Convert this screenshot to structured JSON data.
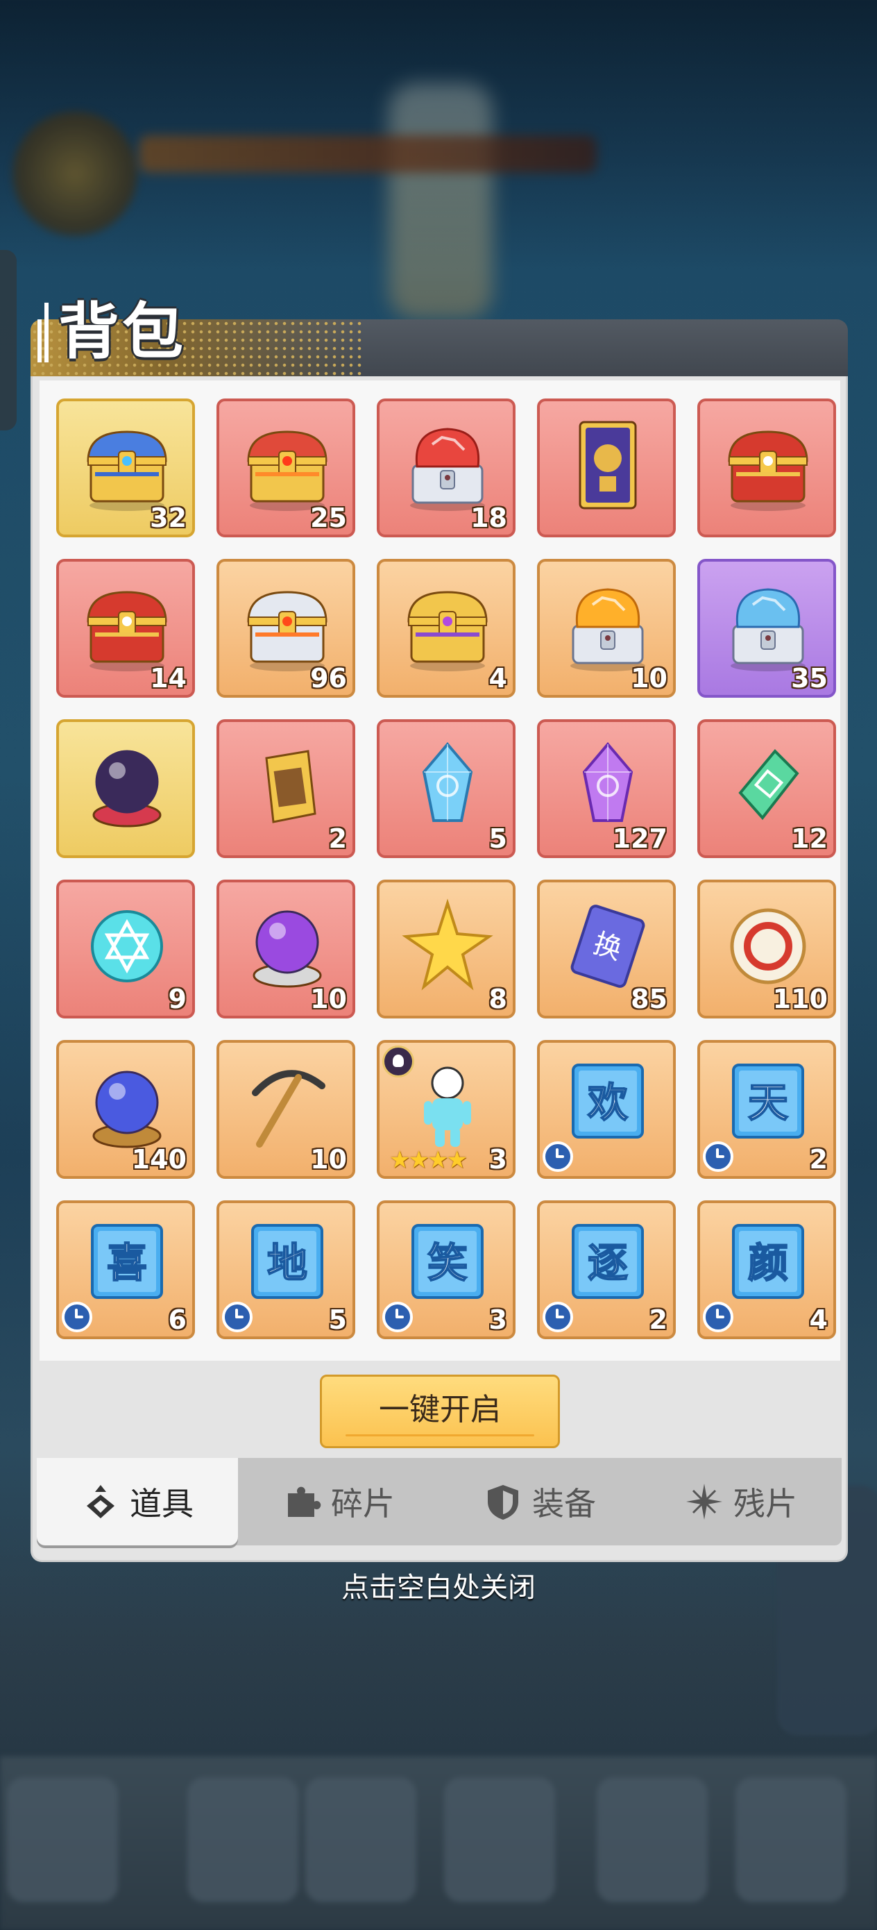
{
  "title": "背包",
  "items": [
    {
      "name": "gold-blue-chest",
      "count": "32",
      "bg": "gold"
    },
    {
      "name": "red-flame-chest",
      "count": "25",
      "bg": "red"
    },
    {
      "name": "red-gem-chest",
      "count": "18",
      "bg": "red"
    },
    {
      "name": "purple-card",
      "count": "",
      "bg": "red"
    },
    {
      "name": "red-gold-chest",
      "count": "",
      "bg": "red"
    },
    {
      "name": "red-gold-chest",
      "count": "14",
      "bg": "red"
    },
    {
      "name": "silver-flame-chest",
      "count": "96",
      "bg": "orange"
    },
    {
      "name": "gold-purple-chest",
      "count": "4",
      "bg": "orange"
    },
    {
      "name": "orange-gem-chest",
      "count": "10",
      "bg": "orange"
    },
    {
      "name": "blue-gem-chest",
      "count": "35",
      "bg": "purple"
    },
    {
      "name": "crystal-ball",
      "count": "",
      "bg": "gold"
    },
    {
      "name": "general-token",
      "count": "2",
      "bg": "red"
    },
    {
      "name": "blue-crystal",
      "count": "5",
      "bg": "red"
    },
    {
      "name": "purple-crystal",
      "count": "127",
      "bg": "red"
    },
    {
      "name": "green-token",
      "count": "12",
      "bg": "red"
    },
    {
      "name": "hexagram-orb",
      "count": "9",
      "bg": "red"
    },
    {
      "name": "purple-orb",
      "count": "10",
      "bg": "red"
    },
    {
      "name": "gold-star",
      "count": "8",
      "bg": "orange"
    },
    {
      "name": "exchange-ticket",
      "count": "85",
      "bg": "orange"
    },
    {
      "name": "dragon-coin",
      "count": "110",
      "bg": "orange"
    },
    {
      "name": "blue-orb",
      "count": "140",
      "bg": "orange"
    },
    {
      "name": "pickaxe",
      "count": "10",
      "bg": "orange"
    },
    {
      "name": "character-figure",
      "count": "3",
      "bg": "orange",
      "stars": "★★★★"
    },
    {
      "name": "char-card",
      "char": "欢",
      "count": "",
      "bg": "orange",
      "timed": true
    },
    {
      "name": "char-card",
      "char": "天",
      "count": "2",
      "bg": "orange",
      "timed": true
    },
    {
      "name": "char-card",
      "char": "喜",
      "count": "6",
      "bg": "orange",
      "timed": true
    },
    {
      "name": "char-card",
      "char": "地",
      "count": "5",
      "bg": "orange",
      "timed": true
    },
    {
      "name": "char-card",
      "char": "笑",
      "count": "3",
      "bg": "orange",
      "timed": true
    },
    {
      "name": "char-card",
      "char": "逐",
      "count": "2",
      "bg": "orange",
      "timed": true
    },
    {
      "name": "char-card",
      "char": "颜",
      "count": "4",
      "bg": "orange",
      "timed": true
    }
  ],
  "open_all_button": "一键开启",
  "tabs": [
    {
      "label": "道具",
      "icon": "item-icon",
      "active": true
    },
    {
      "label": "碎片",
      "icon": "puzzle-icon",
      "active": false
    },
    {
      "label": "装备",
      "icon": "shield-icon",
      "active": false
    },
    {
      "label": "残片",
      "icon": "shard-icon",
      "active": false
    }
  ],
  "close_hint": "点击空白处关闭",
  "colors": {
    "gold": "#eecb62",
    "red": "#ec8279",
    "orange": "#f2b06c",
    "purple": "#a979e2",
    "button": "#fbc24f"
  }
}
